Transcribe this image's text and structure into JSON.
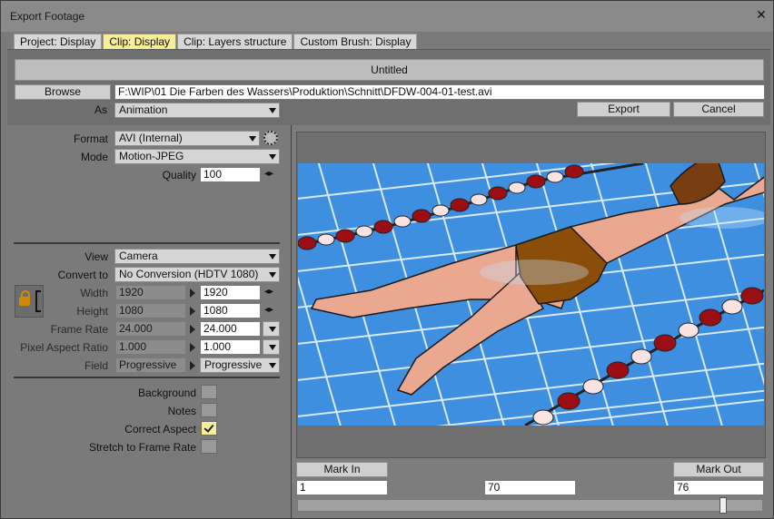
{
  "window": {
    "title": "Export Footage"
  },
  "tabs": [
    {
      "label": "Project: Display"
    },
    {
      "label": "Clip: Display"
    },
    {
      "label": "Clip: Layers structure"
    },
    {
      "label": "Custom Brush: Display"
    }
  ],
  "header": {
    "name": "Untitled"
  },
  "file": {
    "browse_label": "Browse",
    "path": "F:\\WIP\\01 Die Farben des Wassers\\Produktion\\Schnitt\\DFDW-004-01-test.avi",
    "as_label": "As",
    "as_value": "Animation",
    "export_label": "Export",
    "cancel_label": "Cancel"
  },
  "format": {
    "format_label": "Format",
    "format_value": "AVI (Internal)",
    "mode_label": "Mode",
    "mode_value": "Motion-JPEG",
    "quality_label": "Quality",
    "quality_value": "100"
  },
  "output": {
    "view_label": "View",
    "view_value": "Camera",
    "convert_label": "Convert to",
    "convert_value": "No Conversion (HDTV 1080)",
    "width_label": "Width",
    "width_src": "1920",
    "width_dst": "1920",
    "height_label": "Height",
    "height_src": "1080",
    "height_dst": "1080",
    "framerate_label": "Frame Rate",
    "framerate_src": "24.000",
    "framerate_dst": "24.000",
    "aspect_label": "Pixel Aspect Ratio",
    "aspect_src": "1.000",
    "aspect_dst": "1.000",
    "field_label": "Field",
    "field_src": "Progressive",
    "field_dst": "Progressive"
  },
  "options": {
    "background_label": "Background",
    "background_checked": false,
    "notes_label": "Notes",
    "notes_checked": false,
    "correct_aspect_label": "Correct Aspect",
    "correct_aspect_checked": true,
    "stretch_label": "Stretch to Frame Rate",
    "stretch_checked": false
  },
  "timeline": {
    "mark_in_label": "Mark In",
    "mark_out_label": "Mark Out",
    "in_value": "1",
    "current_value": "70",
    "out_value": "76",
    "position_fraction": 0.92
  },
  "colors": {
    "active_tab": "#f7ed9b",
    "pool_water": "#3f8fe0",
    "lane_rope_red": "#9b0f14",
    "swimsuit": "#8a4e0a"
  }
}
